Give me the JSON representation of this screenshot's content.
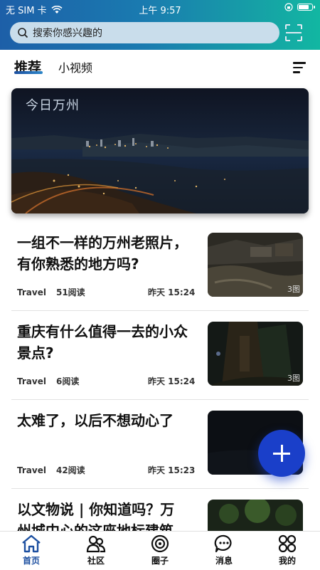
{
  "status_bar": {
    "carrier": "无 SIM 卡",
    "time": "上午 9:57",
    "battery_level": 0.85
  },
  "search": {
    "placeholder": "搜索你感兴趣的"
  },
  "tabs": [
    {
      "label": "推荐"
    },
    {
      "label": "小视频"
    }
  ],
  "banner": {
    "title": "今日万州"
  },
  "articles": [
    {
      "title": "一组不一样的万州老照片，有你熟悉的地方吗?",
      "category": "Travel",
      "reads": "51阅读",
      "time": "昨天 15:24",
      "badge": "3图"
    },
    {
      "title": "重庆有什么值得一去的小众景点?",
      "category": "Travel",
      "reads": "6阅读",
      "time": "昨天 15:24",
      "badge": "3图"
    },
    {
      "title": "太难了，以后不想动心了",
      "category": "Travel",
      "reads": "42阅读",
      "time": "昨天 15:23",
      "badge": ""
    },
    {
      "title": "以文物说 | 你知道吗？万州城中心的这座地标建筑",
      "category": "",
      "reads": "",
      "time": "",
      "badge": ""
    }
  ],
  "bottom_nav": [
    {
      "label": "首页",
      "icon": "home-icon"
    },
    {
      "label": "社区",
      "icon": "community-icon"
    },
    {
      "label": "圈子",
      "icon": "circle-icon"
    },
    {
      "label": "消息",
      "icon": "message-icon"
    },
    {
      "label": "我的",
      "icon": "profile-icon"
    }
  ],
  "colors": {
    "accent": "#1c4fa0",
    "fab": "#1a3fc9",
    "header_start": "#1d5fa8",
    "header_end": "#12b7a2"
  }
}
